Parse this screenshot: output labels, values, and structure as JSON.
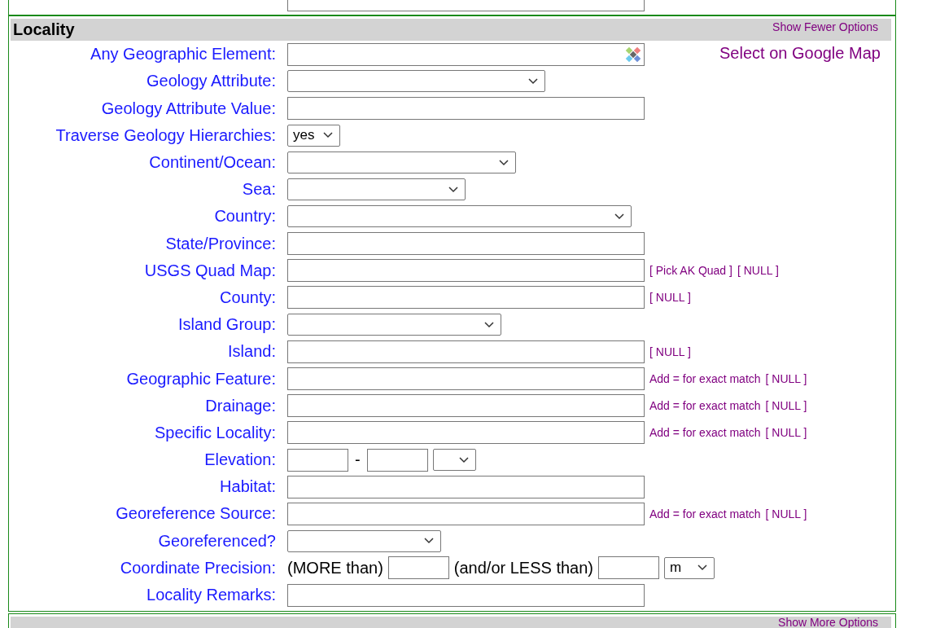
{
  "locality": {
    "title": "Locality",
    "toggle": "Show Fewer Options",
    "map_link": "Select on Google Map",
    "rows": [
      {
        "kind": "geo",
        "label": "Any Geographic Element:"
      },
      {
        "kind": "select",
        "label": "Geology Attribute:"
      },
      {
        "kind": "text",
        "label": "Geology Attribute Value:"
      },
      {
        "kind": "select",
        "label": "Traverse Geology Hierarchies:",
        "value": "yes"
      },
      {
        "kind": "select",
        "label": "Continent/Ocean:"
      },
      {
        "kind": "select",
        "label": "Sea:"
      },
      {
        "kind": "select",
        "label": "Country:"
      },
      {
        "kind": "text",
        "label": "State/Province:"
      },
      {
        "kind": "text",
        "label": "USGS Quad Map:",
        "links": [
          "[ Pick AK Quad ]",
          "[ NULL ]"
        ]
      },
      {
        "kind": "text",
        "label": "County:",
        "links": [
          "[ NULL ]"
        ]
      },
      {
        "kind": "select",
        "label": "Island Group:"
      },
      {
        "kind": "text",
        "label": "Island:",
        "links": [
          "[ NULL ]"
        ]
      },
      {
        "kind": "text",
        "label": "Geographic Feature:",
        "note": "Add = for exact match",
        "links": [
          "[ NULL ]"
        ]
      },
      {
        "kind": "text",
        "label": "Drainage:",
        "note": "Add = for exact match",
        "links": [
          "[ NULL ]"
        ]
      },
      {
        "kind": "text",
        "label": "Specific Locality:",
        "note": "Add = for exact match",
        "links": [
          "[ NULL ]"
        ]
      },
      {
        "kind": "range",
        "label": "Elevation:",
        "separator": "-"
      },
      {
        "kind": "text",
        "label": "Habitat:"
      },
      {
        "kind": "text",
        "label": "Georeference Source:",
        "note": "Add = for exact match",
        "links": [
          "[ NULL ]"
        ]
      },
      {
        "kind": "select",
        "label": "Georeferenced?"
      },
      {
        "kind": "precision",
        "label": "Coordinate Precision:",
        "more": "(MORE than)",
        "less": "(and/or LESS than)",
        "unit": "m"
      },
      {
        "kind": "text",
        "label": "Locality Remarks:"
      }
    ]
  },
  "next_section": {
    "toggle": "Show More Options"
  }
}
